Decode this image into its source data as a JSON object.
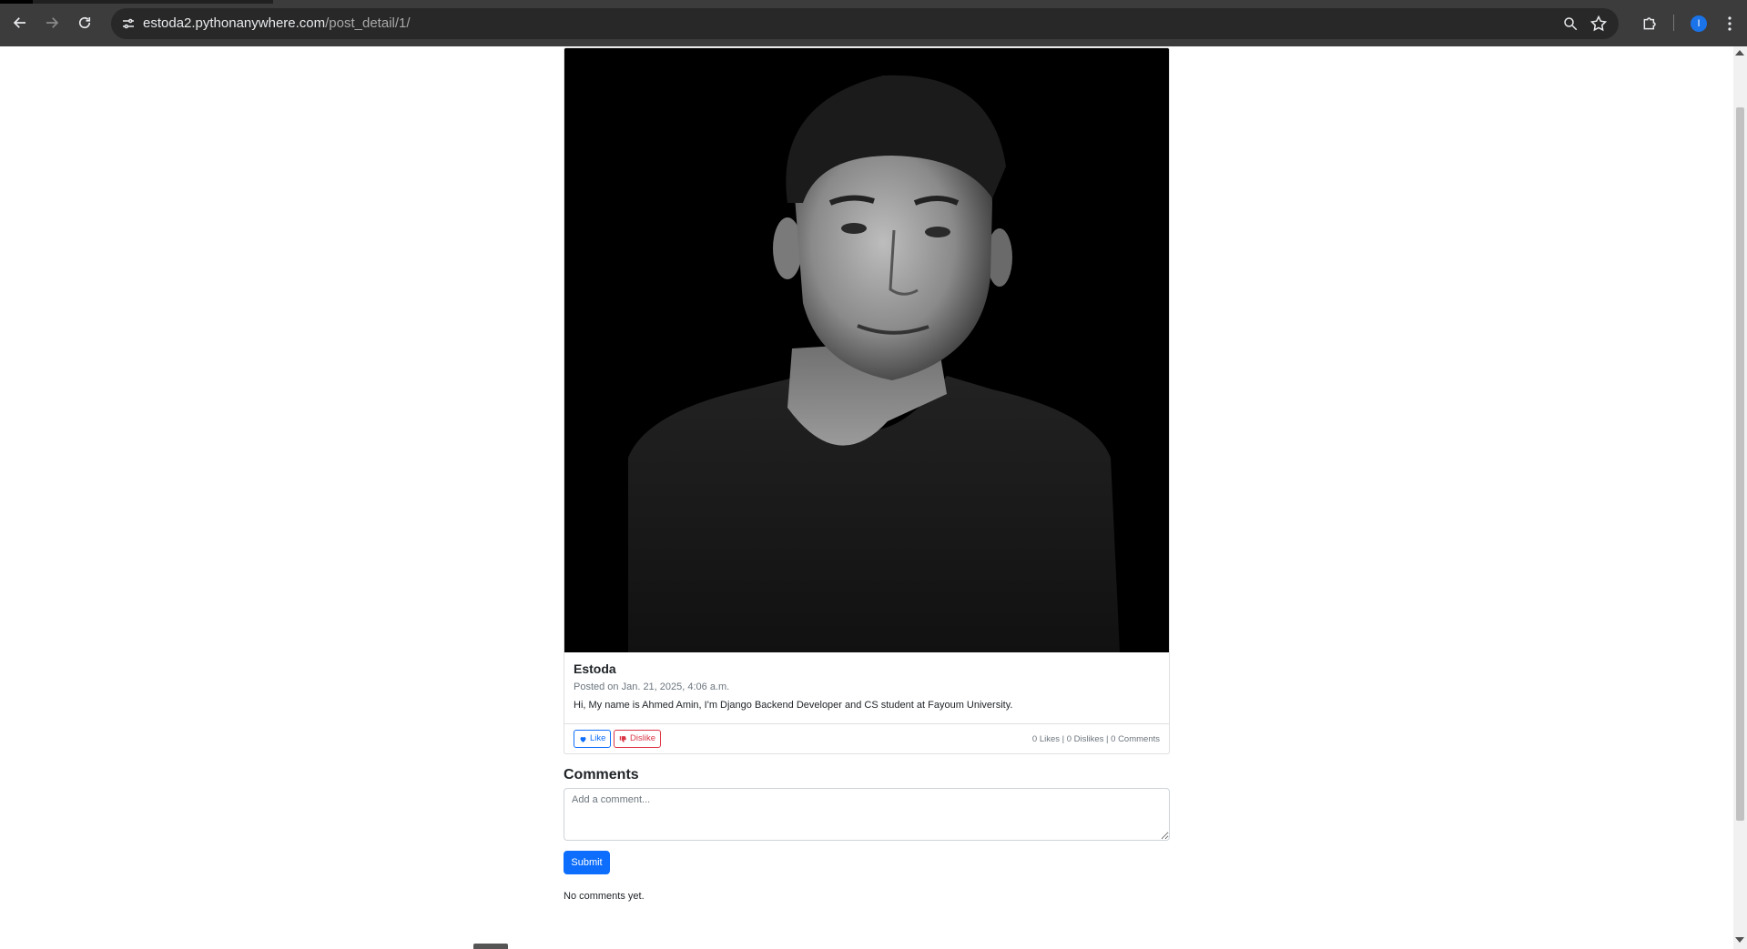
{
  "browser": {
    "url_host": "estoda2.pythonanywhere.com",
    "url_path": "/post_detail/1/",
    "profile_initial": "I"
  },
  "post": {
    "image_alt": "Black and white portrait",
    "author": "Estoda",
    "posted": "Posted on Jan. 21, 2025, 4:06 a.m.",
    "content": "Hi, My name is Ahmed Amin, I'm Django Backend Developer and CS student at Fayoum University.",
    "like_label": "Like",
    "dislike_label": "Dislike",
    "stats": "0 Likes | 0 Dislikes | 0 Comments"
  },
  "comments": {
    "heading": "Comments",
    "placeholder": "Add a comment...",
    "submit_label": "Submit",
    "empty_text": "No comments yet."
  },
  "colors": {
    "primary": "#0d6efd",
    "danger": "#dc3545",
    "chrome_bg": "#3c3c3c"
  }
}
